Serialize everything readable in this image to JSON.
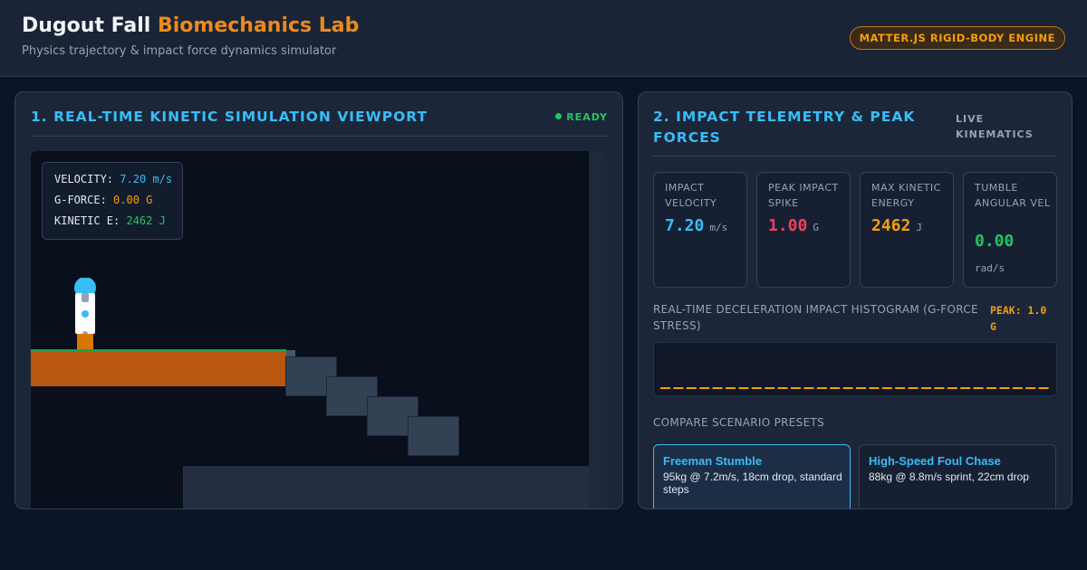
{
  "header": {
    "title_main": "Dugout Fall",
    "title_accent": "Biomechanics Lab",
    "subtitle": "Physics trajectory & impact force dynamics simulator",
    "engine_badge": "MATTER.JS RIGID-BODY ENGINE"
  },
  "simulation": {
    "title": "1. REAL-TIME KINETIC SIMULATION VIEWPORT",
    "status": "READY",
    "hud": {
      "velocity_label": "VELOCITY:",
      "velocity_value": "7.20 m/s",
      "gforce_label": "G-FORCE:",
      "gforce_value": "0.00 G",
      "kinetic_label": "KINETIC E:",
      "kinetic_value": "2462 J"
    }
  },
  "telemetry": {
    "title": "2. IMPACT TELEMETRY & PEAK FORCES",
    "badge": "LIVE KINEMATICS",
    "stats": [
      {
        "label": "IMPACT VELOCITY",
        "value": "7.20",
        "unit": "m/s",
        "color": "#38bdf8"
      },
      {
        "label": "PEAK IMPACT SPIKE",
        "value": "1.00",
        "unit": "G",
        "color": "#f43f5e"
      },
      {
        "label": "MAX KINETIC ENERGY",
        "value": "2462",
        "unit": "J",
        "color": "#f59e0b"
      },
      {
        "label": "TUMBLE ANGULAR VEL",
        "value": "0.00",
        "unit": "rad/s",
        "color": "#22c55e"
      }
    ],
    "histogram_label": "REAL-TIME DECELERATION IMPACT HISTOGRAM (G-FORCE STRESS)",
    "peak_label": "PEAK: 1.0 G",
    "presets_label": "COMPARE SCENARIO PRESETS",
    "presets": [
      {
        "name": "Freeman Stumble",
        "desc": "95kg @ 7.2m/s, 18cm drop, standard steps"
      },
      {
        "name": "High-Speed Foul Chase",
        "desc": "88kg @ 8.8m/s sprint, 22cm drop"
      }
    ]
  },
  "colors": {
    "accent_blue": "#38bdf8",
    "accent_orange": "#f59e0b",
    "accent_green": "#22c55e",
    "accent_red": "#f43f5e",
    "background": "#0c1427"
  }
}
